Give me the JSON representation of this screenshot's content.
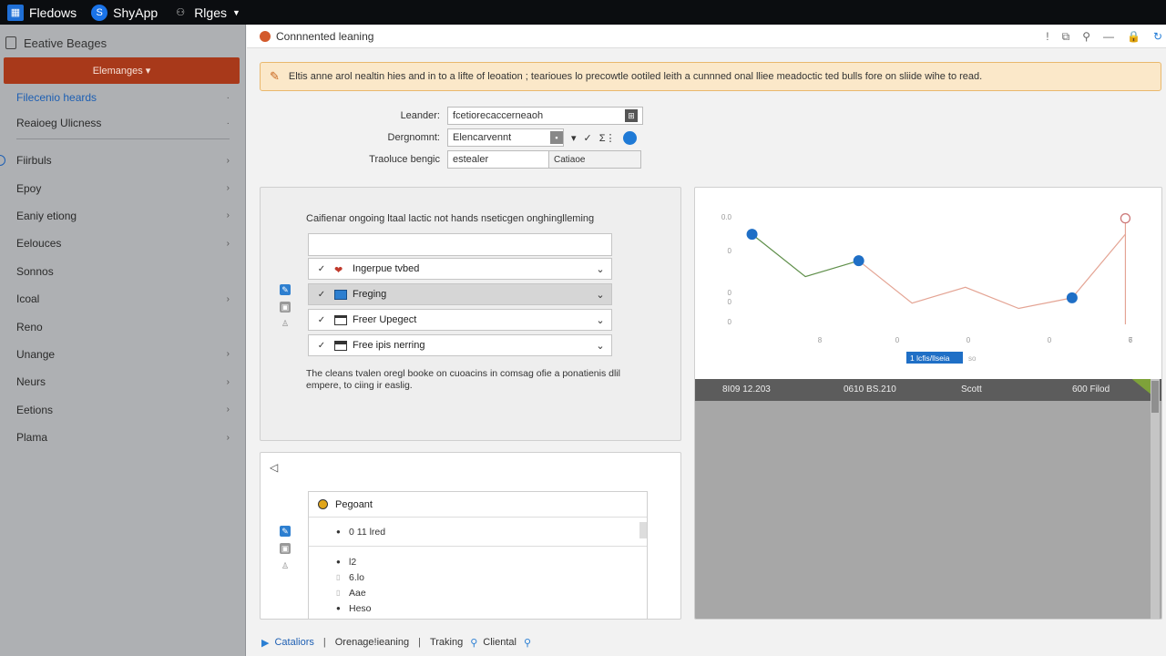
{
  "topbar": {
    "items": [
      {
        "label": "Fledows",
        "icon": "grid-icon"
      },
      {
        "label": "ShyApp",
        "icon": "s-logo-icon"
      },
      {
        "label": "Rlges",
        "icon": "user-group-icon"
      }
    ]
  },
  "sidebar": {
    "header": "Eeative Beages",
    "primary_button": "Elemanges ▾",
    "links": [
      {
        "label": "Filecenio heards"
      },
      {
        "label": "Reaioeg Ulicness"
      }
    ],
    "groups": [
      {
        "label": "Fiirbuls"
      },
      {
        "label": "Epoy"
      },
      {
        "label": "Eaniy etiong"
      },
      {
        "label": "Eelouces"
      },
      {
        "label": "Sonnos"
      },
      {
        "label": "Icoal"
      },
      {
        "label": "Reno"
      },
      {
        "label": "Unange"
      },
      {
        "label": "Neurs"
      },
      {
        "label": "Eetions"
      },
      {
        "label": "Plama"
      }
    ]
  },
  "header": {
    "title": "Connnented leaning",
    "tools": [
      "!",
      "⧉",
      "⚲",
      "—",
      "🔒",
      "↻"
    ]
  },
  "banner": {
    "text": "Eltis anne arol nealtin hies and in to a lifte of leoation ; tearioues lo precowtle ootiled leith a cunnned onal lliee meadoctic ted bulls fore on sliide wihe to read."
  },
  "form": {
    "leander_label": "Leander:",
    "leander_value": "fcetiorecaccerneaoh",
    "dergnomn_label": "Dergnomnt:",
    "dergnomn_value": "Elencarvennt",
    "tracluce_label": "Traoluce bengic",
    "tracluce_value": "estealer",
    "tracluce_side": "Catiaoe"
  },
  "panel1": {
    "title": "Caifienar ongoing ltaal lactic not hands nseticgen onghinglleming",
    "items": [
      {
        "label": "Ingerpue tvbed",
        "icon_color": "#c0392b"
      },
      {
        "label": "Freging",
        "icon_color": "#2d7fd0"
      },
      {
        "label": "Freer Upegect",
        "icon_color": "#333333"
      },
      {
        "label": "Free ipis nerring",
        "icon_color": "#333333"
      }
    ],
    "note": "The cleans tvalen oregl booke on cuoacins in comsag ofie a ponatienis dlil empere, to ciing ir easlig."
  },
  "panel2": {
    "list_title": "Pegoant",
    "rows": [
      {
        "bullet": "●",
        "text": "0   11 lred"
      },
      {
        "bullet": "●",
        "text": "l2"
      },
      {
        "bullet": "▯",
        "text": "6.lo"
      },
      {
        "bullet": "▯",
        "text": "Aae"
      },
      {
        "bullet": "●",
        "text": "Heso"
      }
    ]
  },
  "chart": {
    "legend_label": "1 lcfis/llseia",
    "legend_aside": "so",
    "y_ticks": [
      "0.0",
      "0",
      "0",
      "0",
      "0"
    ],
    "x_ticks": [
      "8",
      "0",
      "0",
      "0",
      "7",
      "6"
    ],
    "table_headers": [
      "8I09 12.203",
      "0610 BS.210",
      "Scott",
      "600 Filod"
    ]
  },
  "chart_data": {
    "type": "line",
    "series": [
      {
        "name": "",
        "color": "#5f8f4a",
        "x": [
          0,
          1,
          2
        ],
        "y": [
          0.85,
          0.45,
          0.6
        ]
      },
      {
        "name": "",
        "color": "#e4a494",
        "x": [
          2,
          3,
          4,
          5,
          6,
          7
        ],
        "y": [
          0.6,
          0.2,
          0.35,
          0.15,
          0.25,
          0.85
        ]
      }
    ],
    "highlight_points": [
      [
        0,
        0.85
      ],
      [
        2,
        0.6
      ],
      [
        6,
        0.25
      ]
    ],
    "marker_point": [
      7,
      1.0
    ],
    "ylim": [
      0,
      1.1
    ],
    "xlim": [
      -0.3,
      7.3
    ]
  },
  "footer": {
    "items": [
      "Cataliors",
      "Orenage!ieaning",
      "Traking",
      "Cliental"
    ]
  },
  "colors": {
    "accent": "#1f7ad6",
    "danger": "#a8391a",
    "sidebar_bg": "#aeb0b3",
    "banner_bg": "#fbe8c9"
  }
}
